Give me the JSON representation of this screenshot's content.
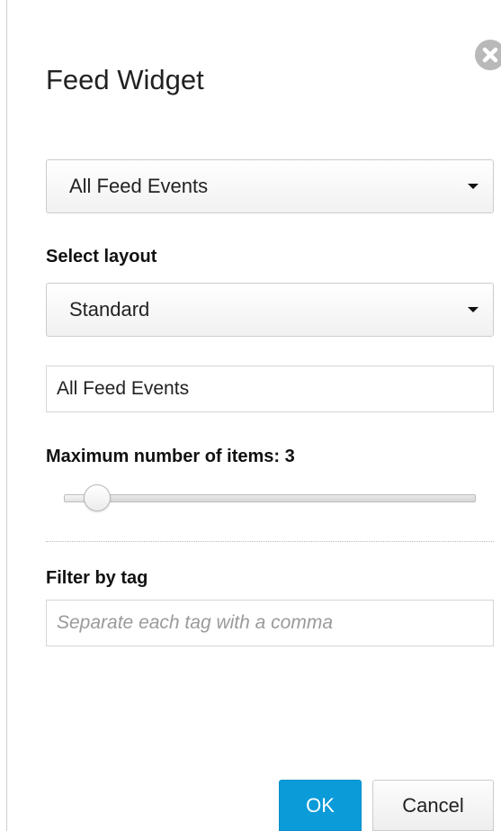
{
  "dialog": {
    "title": "Feed Widget",
    "close_icon": "close-circle-icon"
  },
  "feed_select": {
    "value": "All Feed Events",
    "icon": "caret-down-icon"
  },
  "layout": {
    "label": "Select layout",
    "value": "Standard",
    "icon": "caret-down-icon"
  },
  "title_field": {
    "value": "All Feed Events"
  },
  "max_items": {
    "label": "Maximum number of items: 3",
    "value": 3,
    "slider_fraction": 0.08
  },
  "filter": {
    "label": "Filter by tag",
    "value": "",
    "placeholder": "Separate each tag with a comma"
  },
  "buttons": {
    "ok_label": "OK",
    "cancel_label": "Cancel"
  },
  "colors": {
    "primary_button": "#0a9bd8",
    "close_icon": "#b9b9b9"
  }
}
